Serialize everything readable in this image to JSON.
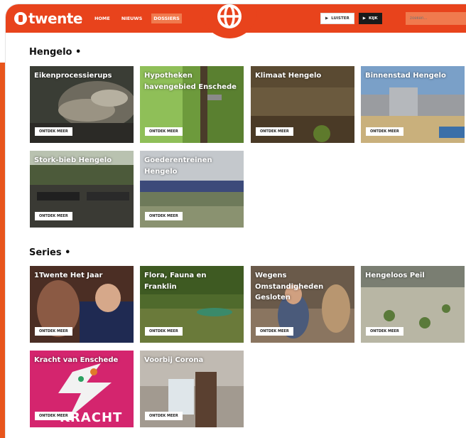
{
  "header": {
    "logo_text": "twente",
    "nav": [
      "HOME",
      "NIEUWS",
      "DOSSIERS"
    ],
    "active_nav": "DOSSIERS",
    "listen_label": "LUISTER",
    "watch_label": "KIJK",
    "search_placeholder": "zoeken..."
  },
  "sections": [
    {
      "title": "Hengelo",
      "cards": [
        {
          "title": "Eikenprocessierups",
          "button": "ONTDEK MEER"
        },
        {
          "title": "Hypotheken havengebied Enschede",
          "button": "ONTDEK MEER"
        },
        {
          "title": "Klimaat Hengelo",
          "button": "ONTDEK MEER"
        },
        {
          "title": "Binnenstad Hengelo",
          "button": "ONTDEK MEER"
        },
        {
          "title": "Stork-bieb Hengelo",
          "button": "ONTDEK MEER"
        },
        {
          "title": "Goederentreinen Hengelo",
          "button": "ONTDEK MEER"
        }
      ]
    },
    {
      "title": "Series",
      "cards": [
        {
          "title": "1Twente Het Jaar",
          "button": "ONTDEK MEER"
        },
        {
          "title": "Flora, Fauna en Franklin",
          "button": "ONTDEK MEER"
        },
        {
          "title": "Wegens Omstandigheden Gesloten",
          "button": "ONTDEK MEER"
        },
        {
          "title": "Hengeloos Peil",
          "button": "ONTDEK MEER"
        },
        {
          "title": "Kracht van Enschede",
          "button": "ONTDEK MEER",
          "overlay_text": "KRACHT"
        },
        {
          "title": "Voorbij Corona",
          "button": "ONTDEK MEER"
        }
      ]
    }
  ],
  "colors": {
    "brand": "#e8431c",
    "accent_light": "#f07a4e"
  }
}
